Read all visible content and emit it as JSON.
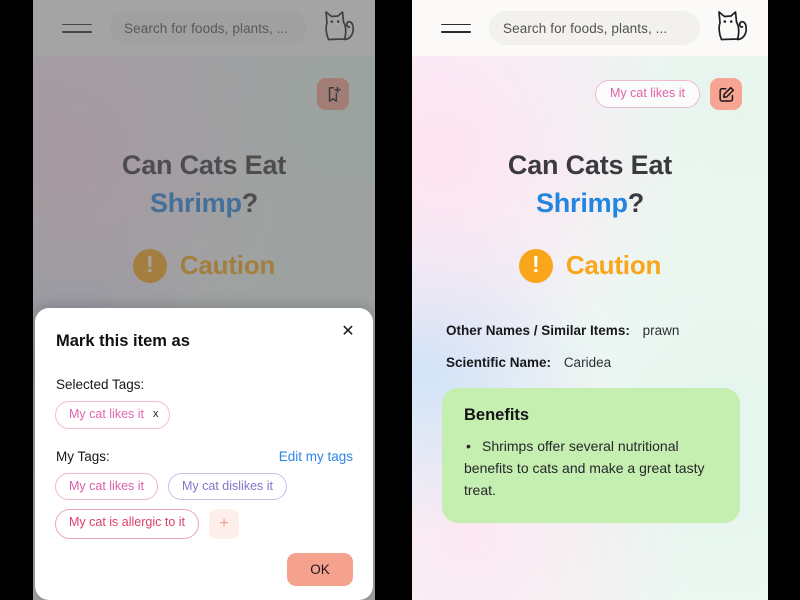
{
  "app": {
    "search_placeholder": "Search for foods, plants, ...",
    "menu_icon": "hamburger-icon",
    "logo_icon": "cat-logo-icon"
  },
  "article": {
    "title_prefix": "Can Cats Eat",
    "subject": "Shrimp",
    "question_mark": "?",
    "verdict": "Caution",
    "verdict_icon": "exclamation-circle-icon",
    "verdict_color": "#f9a61a",
    "assigned_tag": "My cat likes it",
    "edit_icon": "edit-square-icon",
    "bookmark_icon": "bookmark-add-icon",
    "meta": [
      {
        "key": "Other Names / Similar Items:",
        "value": "prawn"
      },
      {
        "key": "Scientific Name:",
        "value": "Caridea"
      }
    ],
    "benefits": {
      "heading": "Benefits",
      "items": [
        "Shrimps offer several nutritional benefits to cats and make a great tasty treat."
      ],
      "bg_color": "#c5eeb1"
    }
  },
  "modal": {
    "title": "Mark this item as",
    "close_icon": "close-icon",
    "close_label": "✕",
    "selected_label": "Selected Tags:",
    "selected_tags": [
      {
        "label": "My cat likes it",
        "remove_label": "x"
      }
    ],
    "my_tags_label": "My Tags:",
    "edit_link": "Edit my tags",
    "my_tags": [
      {
        "label": "My cat likes it",
        "color": "#d95fa8"
      },
      {
        "label": "My cat dislikes it",
        "color": "#7f76c9"
      },
      {
        "label": "My cat is allergic to it",
        "color": "#dd3f6a"
      }
    ],
    "add_tag_label": "+",
    "ok_label": "OK",
    "ok_color": "#f4a18d"
  }
}
